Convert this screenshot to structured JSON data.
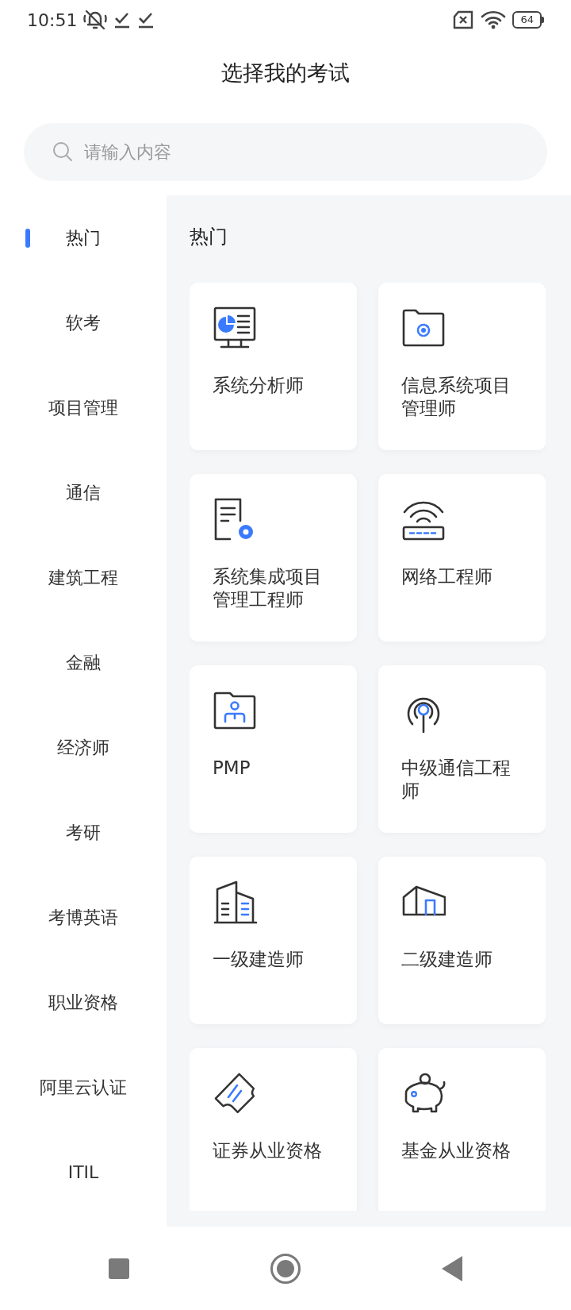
{
  "status_bar": {
    "time": "10:51",
    "battery": "64"
  },
  "header": {
    "title": "选择我的考试"
  },
  "search": {
    "placeholder": "请输入内容"
  },
  "sidebar": {
    "items": [
      {
        "label": "热门",
        "selected": true
      },
      {
        "label": "软考",
        "selected": false
      },
      {
        "label": "项目管理",
        "selected": false
      },
      {
        "label": "通信",
        "selected": false
      },
      {
        "label": "建筑工程",
        "selected": false
      },
      {
        "label": "金融",
        "selected": false
      },
      {
        "label": "经济师",
        "selected": false
      },
      {
        "label": "考研",
        "selected": false
      },
      {
        "label": "考博英语",
        "selected": false
      },
      {
        "label": "职业资格",
        "selected": false
      },
      {
        "label": "阿里云认证",
        "selected": false
      },
      {
        "label": "ITIL",
        "selected": false
      }
    ]
  },
  "section": {
    "title": "热门",
    "cards": [
      {
        "label": "系统分析师"
      },
      {
        "label": "信息系统项目管理师"
      },
      {
        "label": "系统集成项目管理工程师"
      },
      {
        "label": "网络工程师"
      },
      {
        "label": "PMP"
      },
      {
        "label": "中级通信工程师"
      },
      {
        "label": "一级建造师"
      },
      {
        "label": "二级建造师"
      },
      {
        "label": "证券从业资格"
      },
      {
        "label": "基金从业资格"
      }
    ]
  }
}
